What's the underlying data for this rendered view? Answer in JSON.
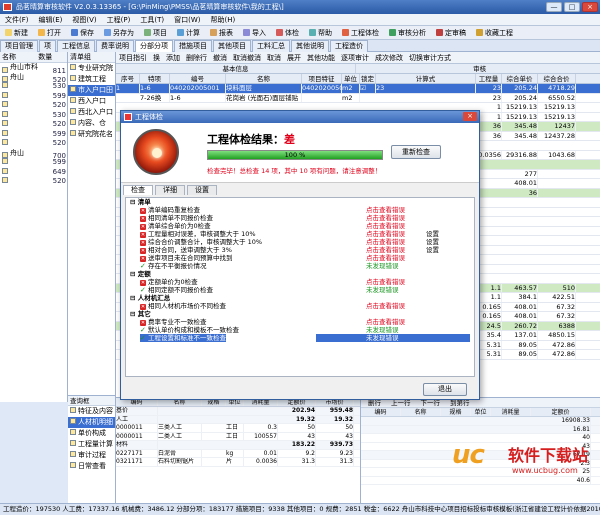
{
  "window": {
    "title": "品茗晴算审核软件 V2.0.3.13365 - [G:\\PinMing\\PMSS\\品茗晴算审核软件\\我的工程\\]",
    "controls": [
      "—",
      "□",
      "×"
    ]
  },
  "menubar": [
    "文件(F)",
    "编辑(E)",
    "视图(V)",
    "工程(P)",
    "工具(T)",
    "窗口(W)",
    "帮助(H)"
  ],
  "toolbar": [
    {
      "label": "新建",
      "icon": "new-icon",
      "color": "#f3d36b"
    },
    {
      "label": "打开",
      "icon": "open-icon",
      "color": "#f3b64b"
    },
    {
      "label": "保存",
      "icon": "save-icon",
      "color": "#4b7bd0"
    },
    {
      "label": "另存为",
      "icon": "save-as-icon",
      "color": "#6a9ae0"
    },
    {
      "label": "项目",
      "icon": "project-icon",
      "color": "#7ab07a"
    },
    {
      "label": "计算",
      "icon": "calc-icon",
      "color": "#5aa0d6"
    },
    {
      "label": "报表",
      "icon": "report-icon",
      "color": "#d6a05a"
    },
    {
      "label": "导入",
      "icon": "import-icon",
      "color": "#8a8ad6"
    },
    {
      "label": "体检",
      "icon": "checkup-icon",
      "color": "#d65a5a"
    },
    {
      "label": "帮助",
      "icon": "help-icon",
      "color": "#5ab0b0"
    },
    {
      "label": "工程体检",
      "icon": "engineering-check-icon",
      "color": "#e06040"
    },
    {
      "label": "审核分析",
      "icon": "audit-analysis-icon",
      "color": "#40a060"
    },
    {
      "label": "定审稿",
      "icon": "final-draft-icon",
      "color": "#c04040"
    },
    {
      "label": "收藏工程",
      "icon": "favorite-icon",
      "color": "#d0a030"
    }
  ],
  "top_tabs": [
    "项目管理",
    "项",
    "工程信息",
    "费率说明",
    "分部分项",
    "措施项目",
    "其他项目",
    "工料汇总",
    "其他说明",
    "工程造价"
  ],
  "left_panel": {
    "header": [
      "名称",
      "数量"
    ],
    "rows": [
      {
        "name": "舟山市科技",
        "num": "811"
      },
      {
        "name": "舟山",
        "num": "520"
      },
      {
        "name": "",
        "num": "530"
      },
      {
        "name": "",
        "num": "599"
      },
      {
        "name": "",
        "num": "520"
      },
      {
        "name": "",
        "num": "530"
      },
      {
        "name": "",
        "num": "520"
      },
      {
        "name": "",
        "num": "599"
      },
      {
        "name": "",
        "num": "520"
      },
      {
        "name": "舟山",
        "num": "700"
      },
      {
        "name": "",
        "num": "599"
      },
      {
        "name": "",
        "num": "649"
      },
      {
        "name": "",
        "num": "520"
      }
    ]
  },
  "mid_tree": {
    "header": "清单组",
    "items": [
      "专业研究院",
      "建筑工程",
      "市入户口田",
      "西入户口",
      "西北入户口",
      "内容、仓",
      "研究院花名"
    ]
  },
  "grid": {
    "toolbar": [
      "项目指引",
      "换",
      "添加",
      "删除行",
      "撤消",
      "取消撤消",
      "取消",
      "展开",
      "其他功能",
      "逐项审计",
      "成次修改",
      "切换审计方式"
    ],
    "header_groups": [
      "基本信息",
      "审核"
    ],
    "columns": [
      "序号",
      "特项",
      "编号",
      "名称",
      "项目特征",
      "单位",
      "锁定",
      "计算式",
      "工程量",
      "综合单价",
      "综合合价"
    ],
    "rows": [
      {
        "cells": [
          "1",
          "1-6",
          "040202005001",
          "块料面层",
          "040202005001",
          "m2",
          "☑",
          "23",
          "23",
          "205.24",
          "4718.29"
        ],
        "sel": true
      },
      {
        "cells": [
          "",
          "7-26换",
          "1-6",
          "花岗岩 (光面石)面层铺贴",
          "",
          "m2",
          "",
          "",
          "23",
          "205.24",
          "6550.52"
        ],
        "sel": false
      },
      {
        "cells": [
          "",
          "",
          "",
          "",
          "",
          "",
          "",
          "",
          "1",
          "15219.13",
          "15219.13"
        ],
        "sel": false
      },
      {
        "cells": [
          "",
          "",
          "",
          "",
          "",
          "",
          "",
          "",
          "1",
          "15219.13",
          "15219.13"
        ],
        "sel": false
      },
      {
        "cells": [
          "",
          "",
          "",
          "",
          "",
          "",
          "",
          "",
          "36",
          "345.48",
          "12437"
        ],
        "sel": false,
        "green": true
      },
      {
        "cells": [
          "",
          "",
          "",
          "",
          "",
          "",
          "",
          "",
          "36",
          "345.48",
          "12437.28"
        ],
        "sel": false
      },
      {
        "cells": [
          "",
          "",
          "",
          "",
          "",
          "",
          "",
          "",
          "",
          "",
          ""
        ],
        "sel": false
      },
      {
        "cells": [
          "",
          "",
          "",
          "",
          "",
          "",
          "",
          "",
          "0.0356",
          "29316.88",
          "1043.68"
        ],
        "sel": false
      },
      {
        "cells": [
          "",
          "",
          "",
          "",
          "",
          "",
          "",
          "",
          "",
          "",
          ""
        ],
        "sel": false,
        "green": true
      },
      {
        "cells": [
          "",
          "",
          "",
          "",
          "",
          "",
          "",
          "",
          "",
          "277",
          ""
        ],
        "sel": false
      },
      {
        "cells": [
          "",
          "",
          "",
          "",
          "",
          "",
          "",
          "",
          "",
          "408.01",
          ""
        ],
        "sel": false
      },
      {
        "cells": [
          "",
          "",
          "",
          "",
          "",
          "",
          "",
          "",
          "",
          "36",
          ""
        ],
        "sel": false,
        "green": true
      },
      {
        "cells": [
          "",
          "",
          "",
          "",
          "",
          "",
          "",
          "",
          "",
          "",
          ""
        ],
        "sel": false
      },
      {
        "cells": [
          "",
          "",
          "",
          "",
          "",
          "",
          "",
          "",
          "",
          "",
          ""
        ],
        "sel": false
      },
      {
        "cells": [
          "",
          "",
          "",
          "",
          "",
          "",
          "",
          "",
          "",
          "",
          ""
        ],
        "sel": false
      },
      {
        "cells": [
          "",
          "",
          "",
          "",
          "",
          "",
          "",
          "",
          "",
          "",
          ""
        ],
        "sel": false
      },
      {
        "cells": [
          "",
          "",
          "",
          "",
          "",
          "",
          "",
          "",
          "",
          "",
          ""
        ],
        "sel": false
      },
      {
        "cells": [
          "",
          "",
          "",
          "",
          "",
          "",
          "",
          "",
          "",
          "",
          ""
        ],
        "sel": false
      },
      {
        "cells": [
          "",
          "",
          "",
          "",
          "",
          "",
          "",
          "",
          "",
          "",
          ""
        ],
        "sel": false
      },
      {
        "cells": [
          "",
          "",
          "",
          "",
          "",
          "",
          "",
          "",
          "",
          "",
          ""
        ],
        "sel": false
      },
      {
        "cells": [
          "",
          "",
          "",
          "",
          "",
          "",
          "",
          "",
          "",
          "",
          ""
        ],
        "sel": false
      },
      {
        "cells": [
          "",
          "",
          "",
          "",
          "",
          "",
          "",
          "",
          "1.1",
          "463.57",
          "510"
        ],
        "sel": false,
        "green": true
      },
      {
        "cells": [
          "",
          "",
          "",
          "",
          "",
          "",
          "",
          "",
          "1.1",
          "384.1",
          "422.51"
        ],
        "sel": false
      },
      {
        "cells": [
          "",
          "",
          "",
          "",
          "",
          "",
          "",
          "",
          "0.165",
          "408.01",
          "67.32"
        ],
        "sel": false
      },
      {
        "cells": [
          "",
          "",
          "",
          "",
          "",
          "",
          "",
          "",
          "0.165",
          "408.01",
          "67.32"
        ],
        "sel": false
      },
      {
        "cells": [
          "",
          "",
          "",
          "",
          "",
          "",
          "",
          "",
          "24.5",
          "260.72",
          "6388"
        ],
        "sel": false,
        "green": true
      },
      {
        "cells": [
          "",
          "",
          "",
          "",
          "",
          "",
          "",
          "",
          "35.4",
          "137.01",
          "4850.15"
        ],
        "sel": false
      },
      {
        "cells": [
          "",
          "",
          "",
          "",
          "",
          "",
          "",
          "",
          "5.31",
          "89.05",
          "472.86"
        ],
        "sel": false
      },
      {
        "cells": [
          "",
          "",
          "",
          "",
          "",
          "",
          "",
          "",
          "5.31",
          "89.05",
          "472.86"
        ],
        "sel": false
      }
    ],
    "right_toolbar": [
      "删行",
      "上一行",
      "下一行",
      "到第行"
    ]
  },
  "dialog": {
    "title": "工程体检",
    "result_label": "工程体检结果：",
    "result_value": "差",
    "progress_text": "100 %",
    "progress": 1.0,
    "summary": "检查完毕！总检查 14 项，其中 10 项有问题，请注意调整！",
    "recheck_button": "重新检查",
    "tabs": [
      "检查",
      "详细",
      "设置"
    ],
    "exit_button": "退出",
    "check_items": [
      {
        "indent": 0,
        "label": "清单",
        "kind": "group",
        "status": "",
        "setting": ""
      },
      {
        "indent": 1,
        "label": "清单编码重复检查",
        "kind": "fail",
        "status": "点击查看错误",
        "setting": ""
      },
      {
        "indent": 1,
        "label": "相同清单不同报价检查",
        "kind": "fail",
        "status": "点击查看错误",
        "setting": ""
      },
      {
        "indent": 1,
        "label": "清单综合单价为0检查",
        "kind": "fail",
        "status": "点击查看错误",
        "setting": ""
      },
      {
        "indent": 1,
        "label": "工程量相对误差，审核调整大于 10%",
        "kind": "fail",
        "status": "点击查看错误",
        "setting": "设置"
      },
      {
        "indent": 1,
        "label": "综合合价调整合计，审核调整大于 10%",
        "kind": "fail",
        "status": "点击查看错误",
        "setting": "设置"
      },
      {
        "indent": 1,
        "label": "相对合同，送审调整大于 3%",
        "kind": "fail",
        "status": "点击查看错误",
        "setting": "设置"
      },
      {
        "indent": 1,
        "label": "送审项目未在合同预算中找到",
        "kind": "fail",
        "status": "点击查看错误",
        "setting": ""
      },
      {
        "indent": 1,
        "label": "存在不平衡报价情况",
        "kind": "ok",
        "status": "未发现错误",
        "setting": ""
      },
      {
        "indent": 0,
        "label": "定额",
        "kind": "group",
        "status": "",
        "setting": ""
      },
      {
        "indent": 1,
        "label": "定额单价为0检查",
        "kind": "fail",
        "status": "点击查看错误",
        "setting": ""
      },
      {
        "indent": 1,
        "label": "相同定额不同报价检查",
        "kind": "ok",
        "status": "未发现错误",
        "setting": ""
      },
      {
        "indent": 0,
        "label": "人材机汇总",
        "kind": "group",
        "status": "",
        "setting": ""
      },
      {
        "indent": 1,
        "label": "相同人材机市场价不同检查",
        "kind": "fail",
        "status": "点击查看错误",
        "setting": ""
      },
      {
        "indent": 0,
        "label": "其它",
        "kind": "group",
        "status": "",
        "setting": ""
      },
      {
        "indent": 1,
        "label": "费率专业不一致检查",
        "kind": "fail",
        "status": "点击查看错误",
        "setting": ""
      },
      {
        "indent": 1,
        "label": "默认单价构成和模板不一致检查",
        "kind": "ok",
        "status": "未发现错误",
        "setting": ""
      },
      {
        "indent": 1,
        "label": "工程设置和标准不一致检查",
        "kind": "ok",
        "status": "未发现错误",
        "setting": "",
        "selected": true
      }
    ]
  },
  "bottom_left": {
    "header": "查询框",
    "items": [
      "特征及内容",
      "人材机明细",
      "单价构成",
      "工程量计算",
      "审计过程",
      "日常查看"
    ]
  },
  "bottom_mid": {
    "columns": [
      "编码",
      "名称",
      "规格",
      "单位",
      "消耗量",
      "定额价",
      "市场价"
    ],
    "rows": [
      {
        "grp": true,
        "cells": [
          "基价",
          "",
          "",
          "",
          "",
          "202.94",
          "959.48"
        ]
      },
      {
        "grp": true,
        "cells": [
          "人工",
          "",
          "",
          "",
          "",
          "19.32",
          "19.32"
        ]
      },
      {
        "grp": false,
        "cells": [
          "0000011",
          "三类人工",
          "",
          "工日",
          "0.3",
          "50",
          "50"
        ]
      },
      {
        "grp": false,
        "cells": [
          "0000011",
          "二类人工",
          "",
          "工日",
          "100557",
          "43",
          "43"
        ]
      },
      {
        "grp": true,
        "cells": [
          "材料",
          "",
          "",
          "",
          "",
          "183.22",
          "939.73"
        ]
      },
      {
        "grp": false,
        "cells": [
          "0227171",
          "白泥膏",
          "",
          "kg",
          "0.01",
          "9.2",
          "9.23"
        ]
      },
      {
        "grp": false,
        "cells": [
          "0321171",
          "石料切割锯片",
          "",
          "片",
          "0.0036",
          "31.3",
          "31.3"
        ]
      }
    ]
  },
  "bottom_right": {
    "columns": [
      "编码",
      "名称",
      "规格",
      "单位",
      "消耗量",
      "定额价"
    ],
    "rows": [
      {
        "grp": true,
        "cells": [
          "",
          "",
          "",
          "",
          "",
          "16908.33"
        ]
      },
      {
        "grp": true,
        "cells": [
          "",
          "",
          "",
          "",
          "",
          "16.81"
        ]
      },
      {
        "grp": false,
        "cells": [
          "",
          "",
          "",
          "",
          "",
          "40"
        ]
      },
      {
        "grp": false,
        "cells": [
          "",
          "",
          "",
          "",
          "",
          "43"
        ]
      },
      {
        "grp": true,
        "cells": [
          "",
          "",
          "",
          "",
          "",
          "67.19"
        ]
      },
      {
        "grp": false,
        "cells": [
          "",
          "",
          "",
          "",
          "",
          "2.3"
        ]
      },
      {
        "grp": false,
        "cells": [
          "",
          "",
          "",
          "",
          "",
          "25"
        ]
      },
      {
        "grp": false,
        "cells": [
          "",
          "",
          "",
          "",
          "",
          "40.6"
        ]
      }
    ]
  },
  "statusbar": "工程造价：197530   人工费：17337.16   机械费：3486.12   分部分项：183177   措施项目：9338   其他项目：0   规费：2851   税金：6622   舟山市科技中心项目招标投标审核模板(浙江省建设工程计价依据2010)   造价服务热线：0571-56075593",
  "watermark": {
    "logo": "uc",
    "text": "软件下载站",
    "url": "www.ucbug.com"
  }
}
